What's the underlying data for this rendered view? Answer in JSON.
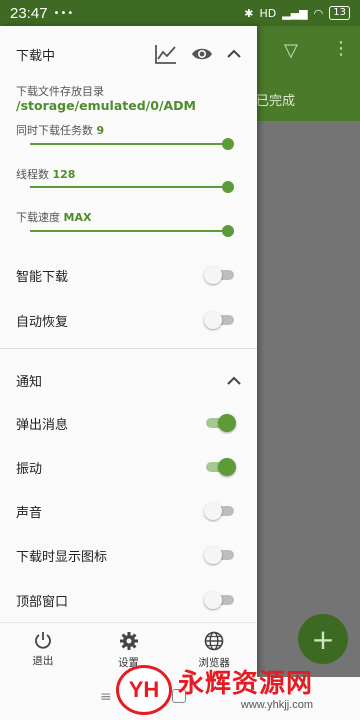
{
  "status_bar": {
    "time": "23:47",
    "dots": "•••",
    "network": "HD",
    "battery": "13"
  },
  "background_app": {
    "tab_label": "已完成",
    "fab_label": "+"
  },
  "drawer": {
    "downloading": {
      "title": "下载中",
      "folder_label": "下载文件存放目录",
      "folder_path": "/storage/emulated/0/ADM",
      "tasks_label": "同时下载任务数",
      "tasks_value": "9",
      "threads_label": "线程数",
      "threads_value": "128",
      "speed_label": "下载速度",
      "speed_value": "MAX",
      "smart_download": "智能下载",
      "auto_resume": "自动恢复"
    },
    "notifications": {
      "title": "通知",
      "popup": "弹出消息",
      "vibrate": "振动",
      "sound": "声音",
      "show_icon": "下载时显示图标",
      "top_window": "顶部窗口"
    },
    "toggles": {
      "smart_download": false,
      "auto_resume": false,
      "popup": true,
      "vibrate": true,
      "sound": false,
      "show_icon": false,
      "top_window": false
    },
    "bottom_nav": {
      "exit": "退出",
      "settings": "设置",
      "browser": "浏览器"
    }
  },
  "watermark": {
    "logo": "YH",
    "text": "永辉资源网",
    "url": "www.yhkjj.com"
  },
  "colors": {
    "accent": "#5d9a38",
    "toolbar": "#4a7a2a",
    "status_bar": "#3f6a24"
  }
}
